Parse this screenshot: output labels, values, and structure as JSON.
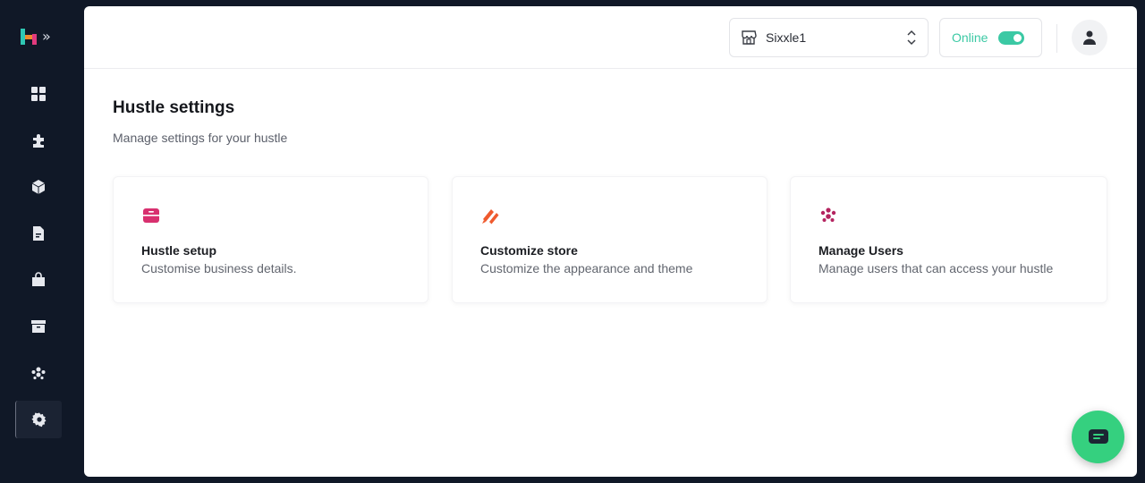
{
  "header": {
    "store_name": "Sixxle1",
    "status_label": "Online",
    "status_on": true
  },
  "page": {
    "title": "Hustle settings",
    "subtitle": "Manage settings for your hustle"
  },
  "cards": [
    {
      "title": "Hustle setup",
      "description": "Customise business details.",
      "icon": "briefcase-icon",
      "color": "#d8306f"
    },
    {
      "title": "Customize store",
      "description": "Customize the appearance and theme",
      "icon": "paint-brush-icon",
      "color": "#ef5a2e"
    },
    {
      "title": "Manage Users",
      "description": "Manage users that can access your hustle",
      "icon": "users-icon",
      "color": "#b4235f"
    }
  ],
  "sidebar": {
    "items": [
      {
        "icon": "dashboard-icon",
        "active": false
      },
      {
        "icon": "puzzle-icon",
        "active": false
      },
      {
        "icon": "box-icon",
        "active": false
      },
      {
        "icon": "document-icon",
        "active": false
      },
      {
        "icon": "bag-icon",
        "active": false
      },
      {
        "icon": "archive-icon",
        "active": false
      },
      {
        "icon": "users-icon",
        "active": false
      },
      {
        "icon": "settings-icon",
        "active": true
      }
    ]
  },
  "colors": {
    "sidebar_bg": "#101827",
    "accent_green": "#3bc9a4",
    "fab_green": "#35d07f",
    "brand_pink": "#e13a7d",
    "brand_teal": "#2fc7b4"
  }
}
